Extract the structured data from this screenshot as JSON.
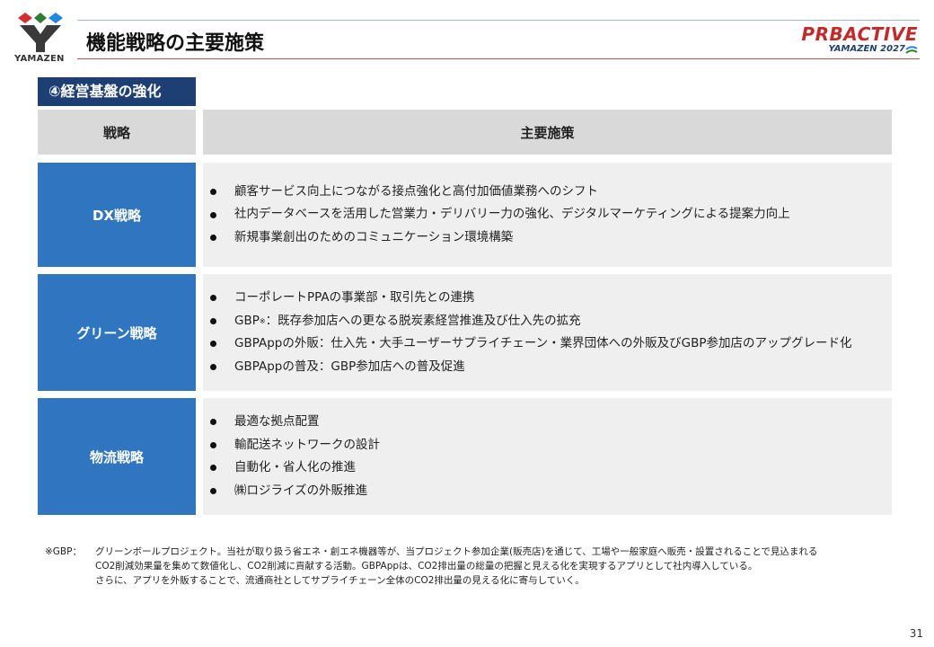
{
  "header": {
    "logo_text": "YAMAZEN",
    "title": "機能戦略の主要施策",
    "brand_main": "PRBACTIVE",
    "brand_sub": "YAMAZEN 2027"
  },
  "section_tag": "④経営基盤の強化",
  "table": {
    "col_strategy": "戦略",
    "col_measures": "主要施策",
    "rows": [
      {
        "strategy": "DX戦略",
        "items": [
          "顧客サービス向上につながる接点強化と高付加価値業務へのシフト",
          "社内データベースを活用した営業力・デリバリー力の強化、デジタルマーケティングによる提案力向上",
          "新規事業創出のためのコミュニケーション環境構築"
        ]
      },
      {
        "strategy": "グリーン戦略",
        "items": [
          "コーポレートPPAの事業部・取引先との連携",
          "：既存参加店への更なる脱炭素経営推進及び仕入先の拡充",
          "GBPAppの外販：仕入先・大手ユーザーサプライチェーン・業界団体への外販及びGBP参加店のアップグレード化",
          "GBPAppの普及：GBP参加店への普及促進"
        ],
        "gbp_prefix": "GBP",
        "gbp_mark": "※"
      },
      {
        "strategy": "物流戦略",
        "items": [
          "最適な拠点配置",
          "輸配送ネットワークの設計",
          "自動化・省人化の推進",
          "㈱ロジライズの外販推進"
        ]
      }
    ]
  },
  "footnote": {
    "label": "※GBP：",
    "line1": "グリーンボールプロジェクト。当社が取り扱う省エネ・創エネ機器等が、当プロジェクト参加企業(販売店)を通じて、工場や一般家庭へ販売・設置されることで見込まれる",
    "line2": "CO2削減効果量を集めて数値化し、CO2削減に貢献する活動。GBPAppは、CO2排出量の総量の把握と見える化を実現するアプリとして社内導入している。",
    "line3": "さらに、アプリを外販することで、流通商社としてサプライチェーン全体のCO2排出量の見える化に寄与していく。"
  },
  "page_number": "31",
  "colors": {
    "navy": "#1d3f73",
    "blue": "#2f75c0",
    "header_gray": "#d9d9d9",
    "row_gray": "#efefef",
    "accent_red": "#c62828"
  }
}
